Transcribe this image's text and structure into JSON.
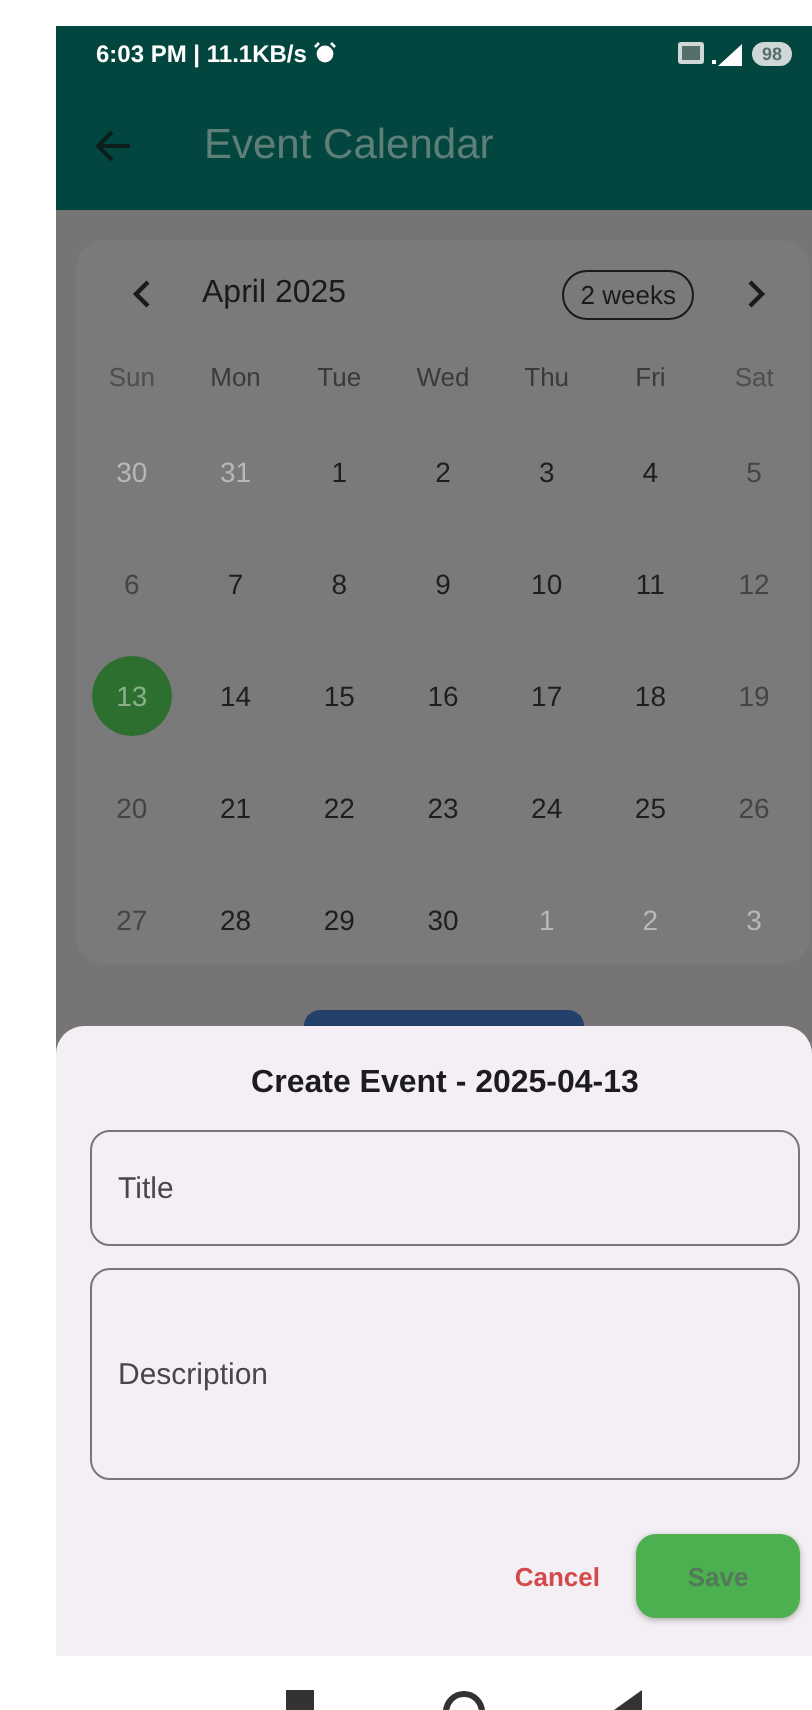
{
  "status_bar": {
    "time": "6:03 PM | 11.1KB/s",
    "battery": "98"
  },
  "app_bar": {
    "title": "Event Calendar"
  },
  "calendar": {
    "month": "April 2025",
    "format_button": "2 weeks",
    "weekdays": [
      "Sun",
      "Mon",
      "Tue",
      "Wed",
      "Thu",
      "Fri",
      "Sat"
    ],
    "weeks": [
      [
        {
          "day": "30",
          "outside": true,
          "selected": false
        },
        {
          "day": "31",
          "outside": true,
          "selected": false
        },
        {
          "day": "1",
          "outside": false,
          "selected": false
        },
        {
          "day": "2",
          "outside": false,
          "selected": false
        },
        {
          "day": "3",
          "outside": false,
          "selected": false
        },
        {
          "day": "4",
          "outside": false,
          "selected": false
        },
        {
          "day": "5",
          "outside": false,
          "selected": false
        }
      ],
      [
        {
          "day": "6",
          "outside": false,
          "selected": false
        },
        {
          "day": "7",
          "outside": false,
          "selected": false
        },
        {
          "day": "8",
          "outside": false,
          "selected": false
        },
        {
          "day": "9",
          "outside": false,
          "selected": false
        },
        {
          "day": "10",
          "outside": false,
          "selected": false
        },
        {
          "day": "11",
          "outside": false,
          "selected": false
        },
        {
          "day": "12",
          "outside": false,
          "selected": false
        }
      ],
      [
        {
          "day": "13",
          "outside": false,
          "selected": true
        },
        {
          "day": "14",
          "outside": false,
          "selected": false
        },
        {
          "day": "15",
          "outside": false,
          "selected": false
        },
        {
          "day": "16",
          "outside": false,
          "selected": false
        },
        {
          "day": "17",
          "outside": false,
          "selected": false
        },
        {
          "day": "18",
          "outside": false,
          "selected": false
        },
        {
          "day": "19",
          "outside": false,
          "selected": false
        }
      ],
      [
        {
          "day": "20",
          "outside": false,
          "selected": false
        },
        {
          "day": "21",
          "outside": false,
          "selected": false
        },
        {
          "day": "22",
          "outside": false,
          "selected": false
        },
        {
          "day": "23",
          "outside": false,
          "selected": false
        },
        {
          "day": "24",
          "outside": false,
          "selected": false
        },
        {
          "day": "25",
          "outside": false,
          "selected": false
        },
        {
          "day": "26",
          "outside": false,
          "selected": false
        }
      ],
      [
        {
          "day": "27",
          "outside": false,
          "selected": false
        },
        {
          "day": "28",
          "outside": false,
          "selected": false
        },
        {
          "day": "29",
          "outside": false,
          "selected": false
        },
        {
          "day": "30",
          "outside": false,
          "selected": false
        },
        {
          "day": "1",
          "outside": true,
          "selected": false
        },
        {
          "day": "2",
          "outside": true,
          "selected": false
        },
        {
          "day": "3",
          "outside": true,
          "selected": false
        }
      ]
    ]
  },
  "dialog": {
    "title": "Create Event - 2025-04-13",
    "fields": [
      {
        "placeholder": "Title",
        "kind": "single"
      },
      {
        "placeholder": "Description",
        "kind": "multi"
      }
    ],
    "cancel": "Cancel",
    "save": "Save"
  }
}
